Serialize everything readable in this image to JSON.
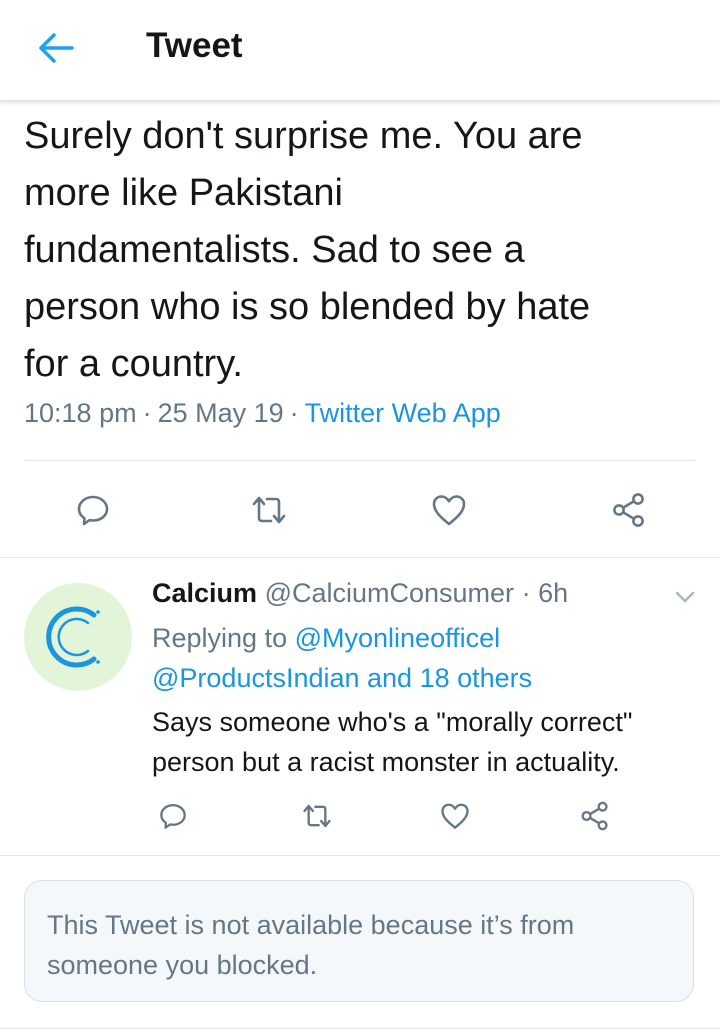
{
  "header": {
    "title": "Tweet",
    "back_icon": "arrow-left-icon",
    "accent": "#1da1f2"
  },
  "tweet": {
    "lines": [
      "Surely don't surprise me. You are",
      "more like Pakistani",
      "fundamentalists. Sad to see a",
      "person who is so blended by hate",
      "for a country."
    ],
    "time": "10:18 pm",
    "date": "25 May 19",
    "source": "Twitter Web App",
    "actions": [
      "reply-icon",
      "retweet-icon",
      "like-icon",
      "share-icon"
    ]
  },
  "reply": {
    "name": "Calcium",
    "handle": "@CalciumConsumer",
    "age": "6h",
    "replying_prefix": "Replying to",
    "replying_user": "@Myonlineofficel",
    "replying_others": "@ProductsIndian and 18 others",
    "text": "Says someone who's a \"morally correct\" person but a racist monster in actuality.",
    "avatar_color": "#e3f5d9",
    "avatar_glyph_color": "#1b95e0"
  },
  "blocked_notice": {
    "text": "This Tweet is not available because it’s from someone you blocked."
  },
  "colors": {
    "text": "#14171a",
    "secondary": "#657786",
    "link": "#1b95e0",
    "border": "#e1e8ed"
  }
}
